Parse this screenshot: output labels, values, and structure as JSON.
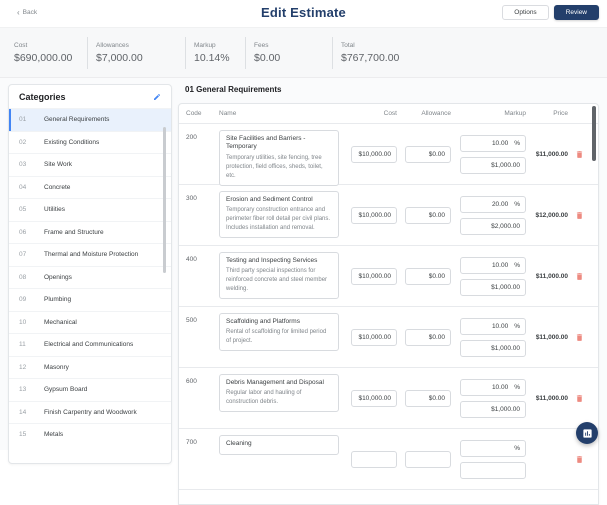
{
  "header": {
    "back_label": "Back",
    "title": "Edit Estimate",
    "options_label": "Options",
    "review_label": "Review"
  },
  "summary": [
    {
      "label": "Cost",
      "value": "$690,000.00"
    },
    {
      "label": "Allowances",
      "value": "$7,000.00"
    },
    {
      "label": "Markup",
      "value": "10.14%"
    },
    {
      "label": "Fees",
      "value": "$0.00"
    },
    {
      "label": "Total",
      "value": "$767,700.00"
    }
  ],
  "sidebar": {
    "title": "Categories",
    "items": [
      {
        "code": "01",
        "label": "General Requirements",
        "selected": true
      },
      {
        "code": "02",
        "label": "Existing Conditions",
        "selected": false
      },
      {
        "code": "03",
        "label": "Site Work",
        "selected": false
      },
      {
        "code": "04",
        "label": "Concrete",
        "selected": false
      },
      {
        "code": "05",
        "label": "Utilities",
        "selected": false
      },
      {
        "code": "06",
        "label": "Frame and Structure",
        "selected": false
      },
      {
        "code": "07",
        "label": "Thermal and Moisture Protection",
        "selected": false
      },
      {
        "code": "08",
        "label": "Openings",
        "selected": false
      },
      {
        "code": "09",
        "label": "Plumbing",
        "selected": false
      },
      {
        "code": "10",
        "label": "Mechanical",
        "selected": false
      },
      {
        "code": "11",
        "label": "Electrical and Communications",
        "selected": false
      },
      {
        "code": "12",
        "label": "Masonry",
        "selected": false
      },
      {
        "code": "13",
        "label": "Gypsum Board",
        "selected": false
      },
      {
        "code": "14",
        "label": "Finish Carpentry and Woodwork",
        "selected": false
      },
      {
        "code": "15",
        "label": "Metals",
        "selected": false
      }
    ]
  },
  "main": {
    "title": "01 General Requirements",
    "columns": [
      "Code",
      "Name",
      "Cost",
      "Allowance",
      "Markup",
      "Price"
    ],
    "percent_sign": "%",
    "rows": [
      {
        "code": "200",
        "name": "Site Facilities and Barriers - Temporary",
        "description": "Temporary utilities, site fencing, tree protection, field offices, sheds, toilet, etc.",
        "cost": "$10,000.00",
        "allowance": "$0.00",
        "markup_pct": "10.00",
        "markup_amt": "$1,000.00",
        "price": "$11,000.00"
      },
      {
        "code": "300",
        "name": "Erosion and Sediment Control",
        "description": "Temporary construction entrance and perimeter fiber roll detail per civil plans. Includes installation and removal.",
        "cost": "$10,000.00",
        "allowance": "$0.00",
        "markup_pct": "20.00",
        "markup_amt": "$2,000.00",
        "price": "$12,000.00"
      },
      {
        "code": "400",
        "name": "Testing and Inspecting Services",
        "description": "Third party special inspections for reinforced concrete and steel member welding.",
        "cost": "$10,000.00",
        "allowance": "$0.00",
        "markup_pct": "10.00",
        "markup_amt": "$1,000.00",
        "price": "$11,000.00"
      },
      {
        "code": "500",
        "name": "Scaffolding and Platforms",
        "description": "Rental of scaffolding for limited period of project.",
        "cost": "$10,000.00",
        "allowance": "$0.00",
        "markup_pct": "10.00",
        "markup_amt": "$1,000.00",
        "price": "$11,000.00"
      },
      {
        "code": "600",
        "name": "Debris Management and Disposal",
        "description": "Regular labor and hauling of construction debris.",
        "cost": "$10,000.00",
        "allowance": "$0.00",
        "markup_pct": "10.00",
        "markup_amt": "$1,000.00",
        "price": "$11,000.00"
      },
      {
        "code": "700",
        "name": "Cleaning",
        "description": "",
        "cost": "",
        "allowance": "",
        "markup_pct": "",
        "markup_amt": "",
        "price": ""
      }
    ]
  },
  "icons": {
    "back_arrow": "‹"
  },
  "colors": {
    "navy": "#233f6b",
    "accent_blue": "#4285f4",
    "selected_bg": "#e9f1fc",
    "delete_red": "#ed8a80"
  }
}
